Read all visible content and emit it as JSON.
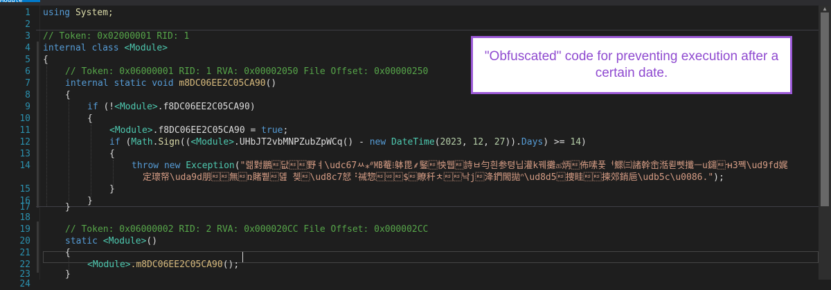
{
  "editor": {
    "tab_label": "Module",
    "line_numbers": [
      "1",
      "2",
      "3",
      "4",
      "5",
      "6",
      "7",
      "8",
      "9",
      "10",
      "11",
      "12",
      "13",
      "14",
      "15",
      "16",
      "17",
      "18",
      "19",
      "20",
      "21",
      "22",
      "23",
      "24"
    ],
    "code": {
      "l1_kw": "using",
      "l1_ns": " System;",
      "l3_comment": "// Token: 0x02000001 RID: 1",
      "l4_kw": "internal class",
      "l4_type": " <Module>",
      "l5": "{",
      "l6_comment": "// Token: 0x06000001 RID: 1 RVA: 0x00002050 File Offset: 0x00000250",
      "l7_kw": "internal static void",
      "l7_method": " m8DC06EE2C05CA90",
      "l7_tail": "()",
      "l8": "{",
      "l9_kw": "if",
      "l9_pre": " (!",
      "l9_type": "<Module>",
      "l9_member": ".f8DC06EE2C05CA90",
      "l9_tail": ")",
      "l10": "{",
      "l11_type": "<Module>",
      "l11_member": ".f8DC06EE2C05CA90 = ",
      "l11_kw": "true",
      "l11_tail": ";",
      "l12_kw": "if",
      "l12_pre": " (",
      "l12_math": "Math",
      "l12_dot": ".",
      "l12_sign": "Sign",
      "l12_paren": "((",
      "l12_type": "<Module>",
      "l12_member": ".UHbJT2vbMNPZubZpWCq",
      "l12_mid": "() - ",
      "l12_new": "new",
      "l12_space": " ",
      "l12_dt": "DateTime",
      "l12_open": "(",
      "l12_n1": "2023",
      "l12_c1": ", ",
      "l12_n2": "12",
      "l12_c2": ", ",
      "l12_n3": "27",
      "l12_close": ")).",
      "l12_days": "Days",
      "l12_cmp": ") >= ",
      "l12_n4": "14",
      "l12_end": ")",
      "l13": "{",
      "l14_throw": "throw new",
      "l14_sp": " ",
      "l14_exc": "Exception",
      "l14_open": "(",
      "l14_str": "\"렒對鵬\u001e닶\u001e\u001e野ㅕ\\udc67ㅆ⁎ᐥ㎆菴⁝躰毘⸙鋻\u001e怏뭽\u001e詩ㅂ勻흰参텽닙灌k꿰攤ಹ炳\u001e佈嗉풏ᅥ鰥㈢諸幹峹湉뢷뻿攕ㅡu鐋\u001e᠊ʜ3쪡\\ud9fd娓",
      "l14b_str": "定瓌帑\\uda9d朋\u001e\u001e無\u001eռ賭쀁\u001e뎶 쳊\u001e\\ud8c7恏⠘祴惣\u001e\u001f\u001e$\u001e瞭䄭ㅊ\u001e\u001e낙j\u001e洚鍆閙拋ᐢ\\ud8d5\u001e捜眭\u001e\u001e揀郊銷巵\\udb5c\\u0086.\"",
      "l14b_tail": ");",
      "l15": "}",
      "l16": "}",
      "l17": "}",
      "l19_comment": "// Token: 0x06000002 RID: 2 RVA: 0x000020CC File Offset: 0x000002CC",
      "l20_kw": "static",
      "l20_type": " <Module>",
      "l20_tail": "()",
      "l21": "{",
      "l22_type": "<Module>",
      "l22_member": ".m8DC06EE2C05CA90",
      "l22_tail": "();",
      "l23": "}"
    }
  },
  "callout": {
    "text": "\"Obfuscated\" code for preventing execution after a certain date."
  },
  "colors": {
    "background": "#1e1e1e",
    "keyword": "#569cd6",
    "comment": "#57a64a",
    "type": "#4ec9b0",
    "method": "#dcdcaa",
    "string": "#d69d85",
    "number": "#b5cea8",
    "line_number": "#2b91af",
    "callout_border": "#9b59d6",
    "callout_text": "#8f4ad0"
  }
}
